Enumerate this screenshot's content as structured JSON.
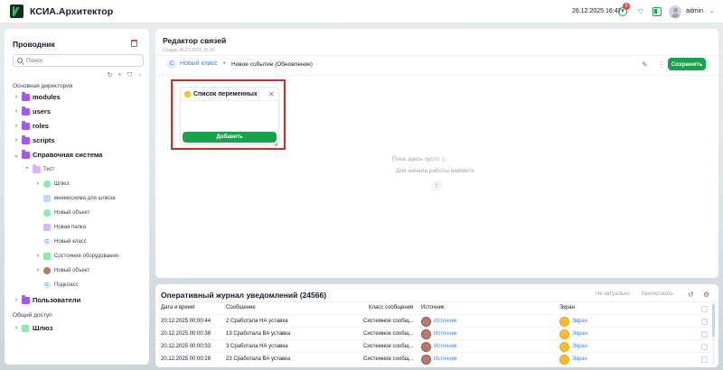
{
  "app": {
    "title": "КСИА.Архитектор",
    "datetime": "26.12.2025 16:47",
    "notification_count": "3",
    "username": "admin"
  },
  "explorer": {
    "title": "Проводник",
    "search_placeholder": "Поиск",
    "main_dir_label": "Основная директория",
    "shared_label": "Общий доступ",
    "items": [
      {
        "label": "modules",
        "icon": "folder-icon",
        "color": "#a855f7"
      },
      {
        "label": "users",
        "icon": "folder-icon",
        "color": "#a855f7"
      },
      {
        "label": "roles",
        "icon": "folder-icon",
        "color": "#a855f7"
      },
      {
        "label": "scripts",
        "icon": "folder-icon",
        "color": "#a855f7"
      },
      {
        "label": "Справочная система",
        "icon": "folder-icon",
        "color": "#a855f7"
      },
      {
        "label": "Тест",
        "icon": "folder-icon",
        "color": "#d8b4fe"
      },
      {
        "label": "Шлюз",
        "icon": "gateway-icon",
        "color": "#86efac"
      },
      {
        "label": "мнемосхема для шлюза",
        "icon": "mnemonic-icon",
        "color": "#bfdbfe"
      },
      {
        "label": "Новый объект",
        "icon": "object-icon",
        "color": "#86efac"
      },
      {
        "label": "Новая папка",
        "icon": "folder-icon",
        "color": "#d8b4fe"
      },
      {
        "label": "Новый класс",
        "icon": "class-icon",
        "color": "#dbeafe"
      },
      {
        "label": "Состояние оборудования",
        "icon": "equipment-icon",
        "color": "#86efac"
      },
      {
        "label": "Новый объект",
        "icon": "object-icon",
        "color": "#b97a6d"
      },
      {
        "label": "Подкласс",
        "icon": "class-icon",
        "color": "#dbeafe"
      },
      {
        "label": "Пользователи",
        "icon": "folder-icon",
        "color": "#a855f7"
      },
      {
        "label": "Шлюз",
        "icon": "gateway-icon",
        "color": "#86efac"
      }
    ]
  },
  "editor": {
    "title": "Редактор связей",
    "created": "Создан 26.12.2025 15:10",
    "breadcrumb_class": "Новый класс",
    "breadcrumb_event": "Новое событие (Обновление)",
    "save_label": "Сохранить",
    "var_card_title": "Список переменных",
    "add_label": "Добавить",
    "empty_text": "Пока здесь пусто :(",
    "empty_hint": "Для начала работы нажмите"
  },
  "log": {
    "title": "Оперативный журнал уведомлений (24566)",
    "btn_inactive": "Не актуально",
    "btn_ack": "Квитировать",
    "columns": [
      "Дата и время",
      "Сообщение",
      "Класс сообщения",
      "Источник",
      "Экран"
    ],
    "rows": [
      {
        "datetime": "20.12.2025 00:00:44",
        "message": "2 Сработала НА уставка",
        "class": "Системное сообщ...",
        "source": "Источник",
        "screen": "Экран"
      },
      {
        "datetime": "20.12.2025 00:00:38",
        "message": "13 Сработала ВА уставка",
        "class": "Системное сообщ...",
        "source": "Источник",
        "screen": "Экран"
      },
      {
        "datetime": "20.12.2025 00:00:33",
        "message": "3 Сработала НА уставка",
        "class": "Системное сообщ...",
        "source": "Источник",
        "screen": "Экран"
      },
      {
        "datetime": "20.12.2025 00:00:28",
        "message": "23 Сработала ВА уставка",
        "class": "Системное сообщ...",
        "source": "Источник",
        "screen": "Экран"
      }
    ]
  },
  "colors": {
    "accent": "#16a34a",
    "link": "#3b82f6",
    "highlight": "#dc2626",
    "folder": "#a855f7"
  }
}
